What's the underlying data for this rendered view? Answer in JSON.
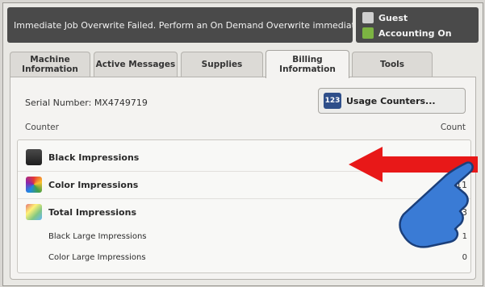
{
  "banner": {
    "message": "Immediate Job Overwrite Failed.  Perform an On Demand Overwrite immediately."
  },
  "user": {
    "name": "Guest",
    "accounting": "Accounting On"
  },
  "tabs": [
    {
      "label": "Machine Information"
    },
    {
      "label": "Active Messages"
    },
    {
      "label": "Supplies"
    },
    {
      "label": "Billing Information"
    },
    {
      "label": "Tools"
    }
  ],
  "billing": {
    "serial": "Serial Number: MX4749719",
    "usage_button": "Usage Counters...",
    "usage_icon_text": "123",
    "counter_header": "Counter",
    "count_header": "Count",
    "rows": [
      {
        "label": "Black Impressions",
        "value": ""
      },
      {
        "label": "Color Impressions",
        "value": "11"
      },
      {
        "label": "Total Impressions",
        "value": "3"
      }
    ],
    "sub_rows": [
      {
        "label": "Black Large Impressions",
        "value": "1"
      },
      {
        "label": "Color Large Impressions",
        "value": "0"
      }
    ]
  },
  "colors": {
    "banner_bg": "#4a4a4a",
    "arrow": "#e81818",
    "hand": "#3a7bd5"
  },
  "icons": [
    "guest-icon",
    "accounting-icon",
    "usage-counter-icon",
    "black-impressions-icon",
    "color-impressions-icon",
    "total-impressions-icon",
    "pointing-hand-icon",
    "red-arrow-icon"
  ]
}
